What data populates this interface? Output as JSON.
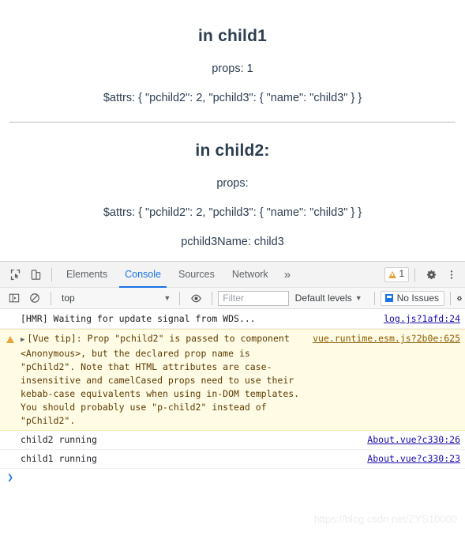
{
  "page": {
    "child1": {
      "heading": "in child1",
      "props_line": "props: 1",
      "attrs_line": "$attrs: { \"pchild2\": 2, \"pchild3\": { \"name\": \"child3\" } }"
    },
    "child2": {
      "heading": "in child2:",
      "props_line": "props:",
      "attrs_line": "$attrs: { \"pchild2\": 2, \"pchild3\": { \"name\": \"child3\" } }",
      "pchild3name_line": "pchild3Name: child3"
    }
  },
  "devtools": {
    "toolbar": {
      "inspect_icon": "inspect-element-icon",
      "device_icon": "device-toolbar-icon",
      "tabs": [
        {
          "label": "Elements",
          "active": false
        },
        {
          "label": "Console",
          "active": true
        },
        {
          "label": "Sources",
          "active": false
        },
        {
          "label": "Network",
          "active": false
        }
      ],
      "more_tabs_label": "»",
      "warning_count": "1",
      "settings_icon": "gear-icon",
      "more_options_icon": "kebab-menu-icon"
    },
    "filterbar": {
      "execute_icon": "console-sidebar-icon",
      "clear_icon": "clear-console-icon",
      "context": "top",
      "context_caret": "▼",
      "eye_icon": "live-expression-eye-icon",
      "filter_placeholder": "Filter",
      "filter_value": "",
      "levels_label": "Default levels",
      "levels_caret": "▼",
      "issues_label": "No Issues",
      "settings_edge_icon": "gear-icon"
    },
    "messages": [
      {
        "type": "log",
        "disclosure": "",
        "text": "[HMR] Waiting for update signal from WDS...",
        "source": "log.js?1afd:24"
      },
      {
        "type": "warning",
        "disclosure": "▶",
        "text": "[Vue tip]: Prop \"pchild2\" is passed to component <Anonymous>, but the declared prop name is \"pChild2\". Note that HTML attributes are case-insensitive and camelCased props need to use their kebab-case equivalents when using in-DOM templates. You should probably use \"p-child2\" instead of \"pChild2\".",
        "source": "vue.runtime.esm.js?2b0e:625"
      },
      {
        "type": "log",
        "disclosure": "",
        "text": "child2 running",
        "source": "About.vue?c330:26"
      },
      {
        "type": "log",
        "disclosure": "",
        "text": "child1 running",
        "source": "About.vue?c330:23"
      }
    ],
    "prompt_symbol": "❯"
  },
  "watermark": "https://blog.csdn.net/ZYS10000",
  "colors": {
    "accent": "#1a73e8",
    "warning": "#e8a33d",
    "warning_bg": "#fffbe5",
    "text": "#2c3e50",
    "link": "#1a0dab"
  }
}
